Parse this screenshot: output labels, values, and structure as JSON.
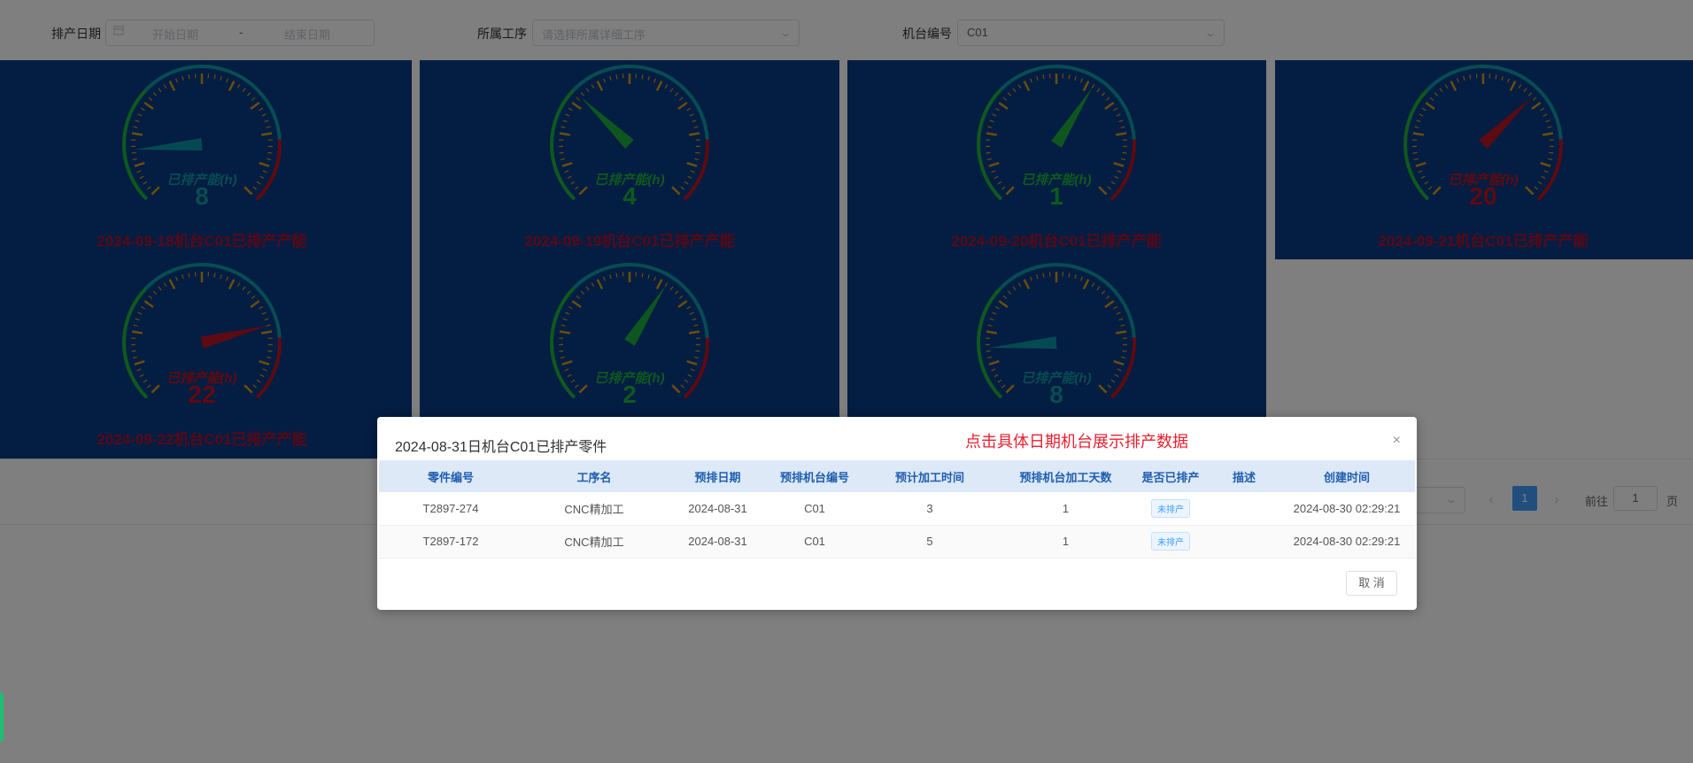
{
  "filters": {
    "date_label": "排产日期",
    "start_placeholder": "开始日期",
    "range_separator": "-",
    "end_placeholder": "结束日期",
    "process_label": "所属工序",
    "process_placeholder": "请选择所属详细工序",
    "machine_label": "机台编号",
    "machine_value": "C01"
  },
  "gauge_title": "已排产能(h)",
  "colors": {
    "panel_bg": "#083a85",
    "teal": "#0c9aa6",
    "green": "#1db33a",
    "red": "#c0141e",
    "caption": "#b3102a",
    "tick": "#d99a12"
  },
  "gauges": [
    {
      "value": "8",
      "caption": "2024-09-18机台C01已排产产能",
      "color": "teal",
      "fraction": 0.15
    },
    {
      "value": "4",
      "caption": "2024-09-19机台C01已排产产能",
      "color": "green",
      "fraction": 0.33
    },
    {
      "value": "1",
      "caption": "2024-09-20机台C01已排产产能",
      "color": "green",
      "fraction": 0.62
    },
    {
      "value": "20",
      "caption": "2024-09-21机台C01已排产产能",
      "color": "red",
      "fraction": 0.67
    },
    {
      "value": "22",
      "caption": "2024-09-22机台C01已排产产能",
      "color": "red",
      "fraction": 0.78
    },
    {
      "value": "2",
      "caption": "",
      "color": "green",
      "fraction": 0.62
    },
    {
      "value": "8",
      "caption": "",
      "color": "teal",
      "fraction": 0.15
    }
  ],
  "pagination": {
    "current_page": "1",
    "goto_label": "前往",
    "goto_value": "1",
    "page_unit": "页",
    "prev_icon": "‹",
    "next_icon": "›"
  },
  "dialog": {
    "title": "2024-08-31日机台C01已排产零件",
    "annotation": "点击具体日期机台展示排产数据",
    "close_icon": "×",
    "columns": [
      "零件编号",
      "工序名",
      "预排日期",
      "预排机台编号",
      "预计加工时间",
      "预排机台加工天数",
      "是否已排产",
      "描述",
      "创建时间"
    ],
    "rows": [
      [
        "T2897-274",
        "CNC精加工",
        "2024-08-31",
        "C01",
        "3",
        "1",
        "未排产",
        "",
        "2024-08-30 02:29:21"
      ],
      [
        "T2897-172",
        "CNC精加工",
        "2024-08-31",
        "C01",
        "5",
        "1",
        "未排产",
        "",
        "2024-08-30 02:29:21"
      ]
    ],
    "cancel_label": "取 消"
  }
}
